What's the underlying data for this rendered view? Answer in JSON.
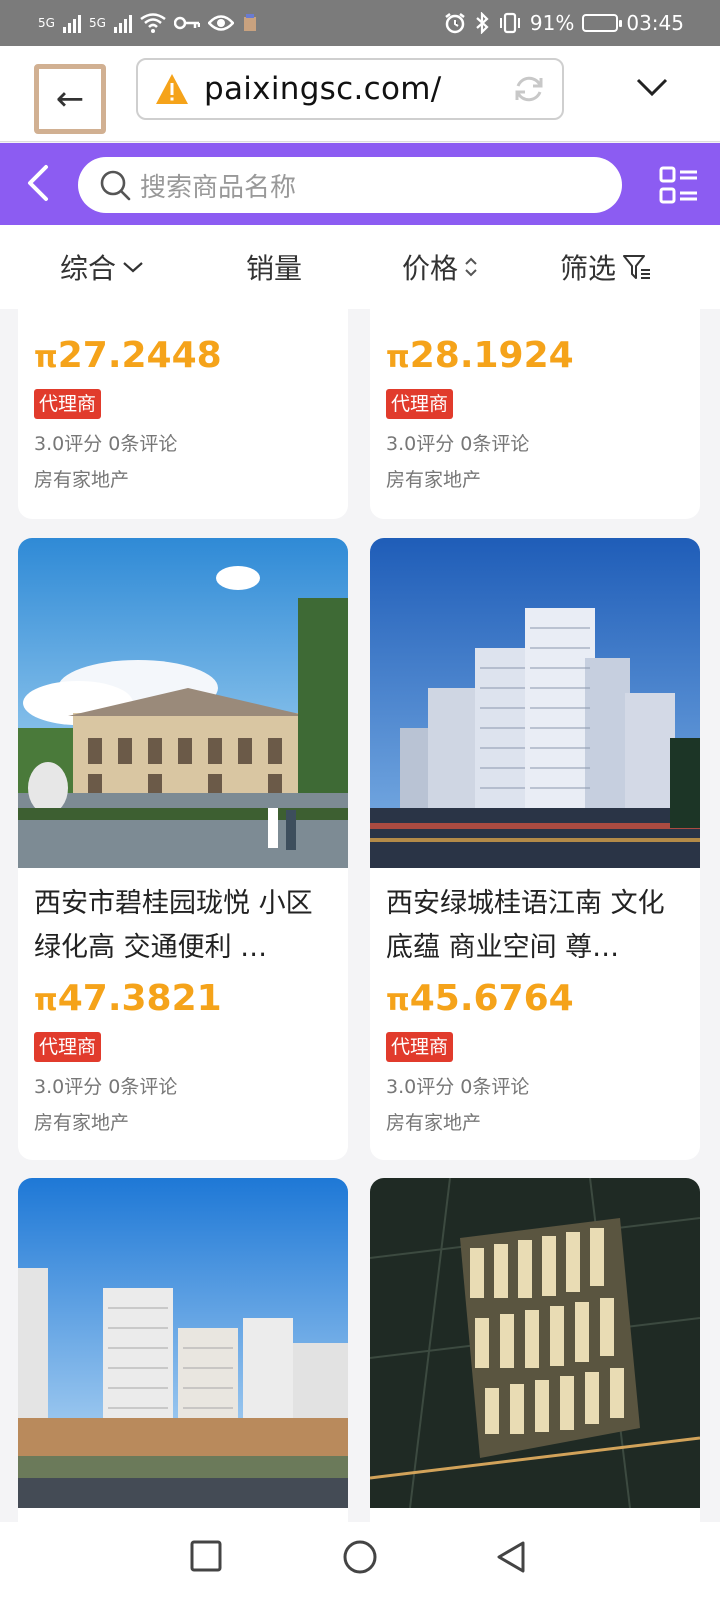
{
  "status_bar": {
    "network_1": "5G",
    "network_2": "5G",
    "battery_percent": "91%",
    "time": "03:45",
    "battery_level": 0.91,
    "icons": [
      "signal-icon",
      "wifi-icon",
      "vpn-key-icon",
      "eye-icon",
      "alarm-icon",
      "bluetooth-icon",
      "vibrate-icon",
      "battery-icon"
    ]
  },
  "browser": {
    "url": "paixingsc.com/"
  },
  "search": {
    "placeholder": "搜索商品名称"
  },
  "filters": {
    "comprehensive": "综合",
    "sales": "销量",
    "price": "价格",
    "filter": "筛选"
  },
  "products": [
    {
      "price_symbol": "π",
      "price_value": "27.2448",
      "tag": "代理商",
      "rating": "3.0评分 0条评论",
      "shop": "房有家地产"
    },
    {
      "price_symbol": "π",
      "price_value": "28.1924",
      "tag": "代理商",
      "rating": "3.0评分 0条评论",
      "shop": "房有家地产"
    },
    {
      "title": "西安市碧桂园珑悦 小区绿化高 交通便利 …",
      "price_symbol": "π",
      "price_value": "47.3821",
      "tag": "代理商",
      "rating": "3.0评分 0条评论",
      "shop": "房有家地产"
    },
    {
      "title": "西安绿城桂语江南 文化底蕴 商业空间 尊…",
      "price_symbol": "π",
      "price_value": "45.6764",
      "tag": "代理商",
      "rating": "3.0评分 0条评论",
      "shop": "房有家地产"
    }
  ],
  "colors": {
    "header_purple": "#8c5cf2",
    "price_orange": "#f5a31a",
    "tag_red": "#e13b2c"
  }
}
